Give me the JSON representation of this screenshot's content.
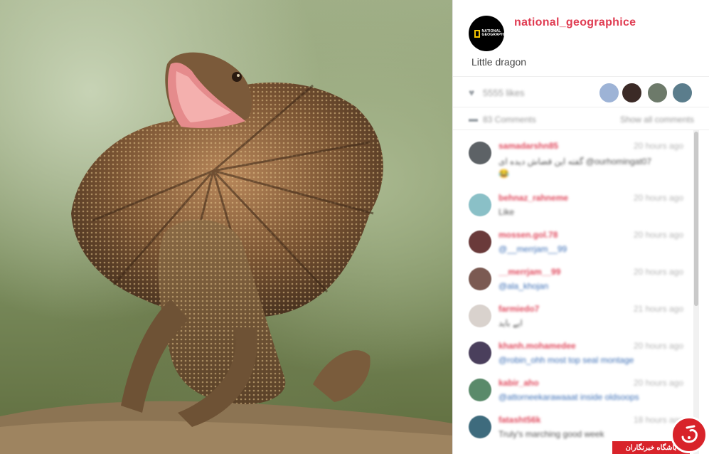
{
  "post": {
    "username": "national_geographice",
    "caption": "Little dragon",
    "logo_text": "NATIONAL GEOGRAPHIC"
  },
  "stats": {
    "likes": "5555 likes",
    "comments": "83 Comments",
    "show_all": "Show all comments"
  },
  "comments": [
    {
      "user": "samadarshn85",
      "time": "20 hours ago",
      "text": "گفته این قضاش دیده ای @ourhomingat07",
      "text2": "😂",
      "avatar": "#5d6266"
    },
    {
      "user": "behnaz_rahneme",
      "time": "20 hours ago",
      "text": "Like",
      "avatar": "#8ac0c7"
    },
    {
      "user": "mossen.gol.78",
      "time": "20 hours ago",
      "text": "@__merrjam__99",
      "avatar": "#6a3a3a",
      "blue": true
    },
    {
      "user": "__merrjam__99",
      "time": "20 hours ago",
      "text": "@ala_khojan",
      "avatar": "#7b5a52",
      "blue": true
    },
    {
      "user": "farmiedo7",
      "time": "21 hours ago",
      "text": "ایے باید",
      "avatar": "#d9d2cd"
    },
    {
      "user": "khanh.mohamedee",
      "time": "20 hours ago",
      "text": "@robin_ohh most top seal montage",
      "avatar": "#4a3f5c",
      "blue": true
    },
    {
      "user": "kabir_aho",
      "time": "20 hours ago",
      "text": "@attorneekarawaaat inside oldsoops",
      "avatar": "#5a8a6a",
      "blue": true
    },
    {
      "user": "fatasht56k",
      "time": "18 hours ago",
      "text": "Truly's marching good week",
      "avatar": "#3e6b7d"
    }
  ],
  "watermark": {
    "text": "باشگاه خبرنگاران",
    "color": "#d8232a"
  }
}
